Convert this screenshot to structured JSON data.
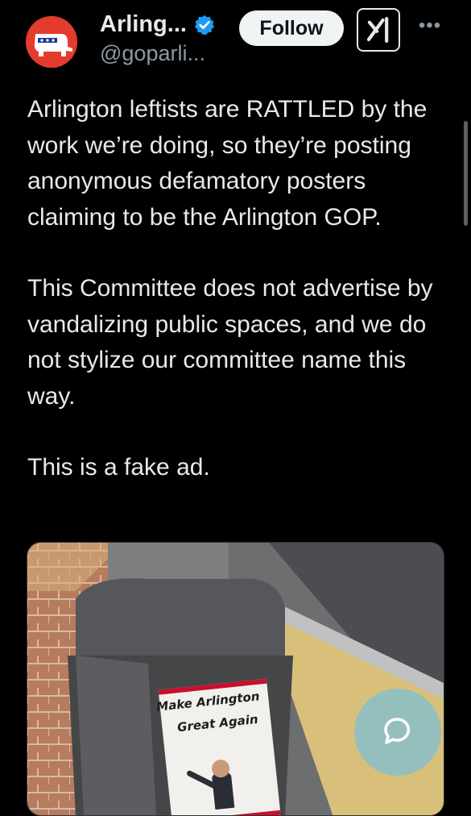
{
  "header": {
    "display_name": "Arling...",
    "handle": "@goparli...",
    "follow_label": "Follow",
    "more_label": "•••"
  },
  "tweet": {
    "paragraphs": [
      "Arlington leftists are RATTLED by the work we’re doing, so they’re posting anonymous defamatory posters claiming to be the Arlington GOP.",
      "This Committee does not advertise by vandalizing public spaces, and we do not stylize our committee name this way.",
      "This is a fake ad."
    ]
  },
  "media": {
    "poster_line1": "Make Arlington",
    "poster_line2": "Great Again"
  },
  "icons": {
    "avatar": "republican-elephant-logo",
    "verified": "verified-badge-icon",
    "grok": "grok-icon",
    "more": "more-icon",
    "fab": "chat-bubble-icon"
  },
  "colors": {
    "background": "#000000",
    "text": "#e7e9ea",
    "secondary_text": "#8b98a5",
    "verified_blue": "#1d9bf0",
    "avatar_red": "#e33b2e",
    "follow_bg": "#eff3f4"
  }
}
